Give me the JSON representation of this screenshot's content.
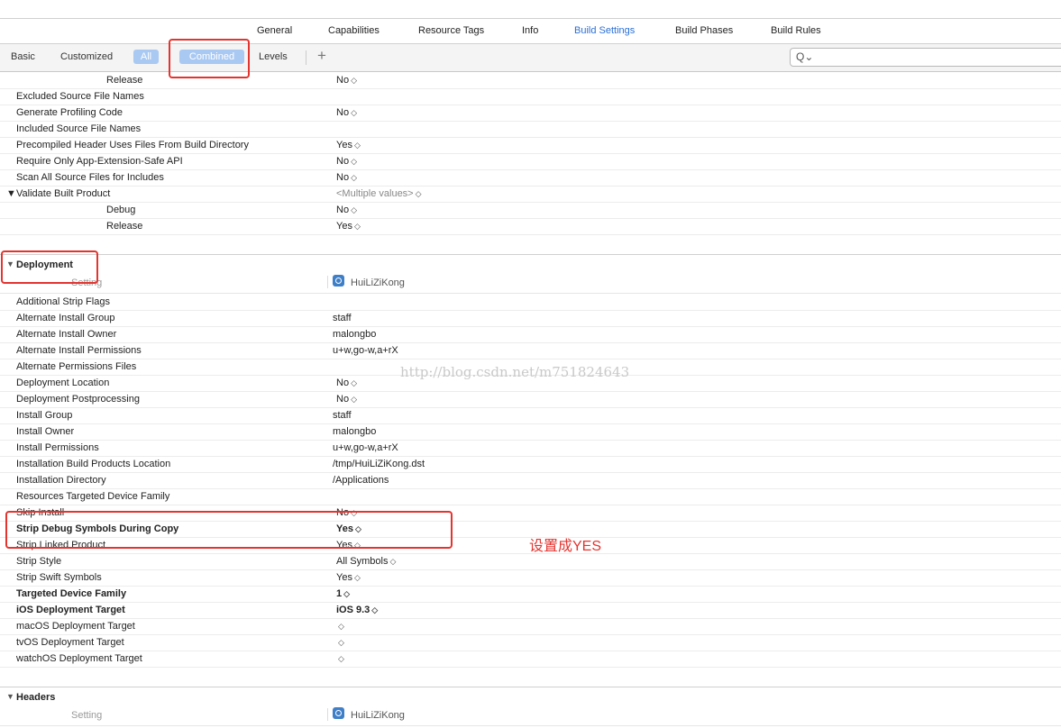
{
  "tabs": [
    "General",
    "Capabilities",
    "Resource Tags",
    "Info",
    "Build Settings",
    "Build Phases",
    "Build Rules"
  ],
  "active_tab": "Build Settings",
  "filter": {
    "basic": "Basic",
    "customized": "Customized",
    "all": "All",
    "combined": "Combined",
    "levels": "Levels",
    "plus": "+",
    "search_icon": "Q⌄"
  },
  "top_rows": [
    {
      "label": "Release",
      "value": "No"
    },
    {
      "label": "Excluded Source File Names",
      "value": ""
    },
    {
      "label": "Generate Profiling Code",
      "value": "No"
    },
    {
      "label": "Included Source File Names",
      "value": ""
    },
    {
      "label": "Precompiled Header Uses Files From Build Directory",
      "value": "Yes"
    },
    {
      "label": "Require Only App-Extension-Safe API",
      "value": "No"
    },
    {
      "label": "Scan All Source Files for Includes",
      "value": "No"
    },
    {
      "label": "Validate Built Product",
      "value": "<Multiple values>"
    },
    {
      "label": "Debug",
      "value": "No"
    },
    {
      "label": "Release",
      "value": "Yes"
    }
  ],
  "deployment": {
    "title": "Deployment",
    "col_setting": "Setting",
    "col_target": "HuiLiZiKong",
    "rows": [
      {
        "label": "Additional Strip Flags",
        "value": ""
      },
      {
        "label": "Alternate Install Group",
        "value": "staff"
      },
      {
        "label": "Alternate Install Owner",
        "value": "malongbo"
      },
      {
        "label": "Alternate Install Permissions",
        "value": "u+w,go-w,a+rX"
      },
      {
        "label": "Alternate Permissions Files",
        "value": ""
      },
      {
        "label": "Deployment Location",
        "value": "No"
      },
      {
        "label": "Deployment Postprocessing",
        "value": "No"
      },
      {
        "label": "Install Group",
        "value": "staff"
      },
      {
        "label": "Install Owner",
        "value": "malongbo"
      },
      {
        "label": "Install Permissions",
        "value": "u+w,go-w,a+rX"
      },
      {
        "label": "Installation Build Products Location",
        "value": "/tmp/HuiLiZiKong.dst"
      },
      {
        "label": "Installation Directory",
        "value": "/Applications"
      },
      {
        "label": "Resources Targeted Device Family",
        "value": ""
      },
      {
        "label": "Skip Install",
        "value": "No"
      },
      {
        "label": "Strip Debug Symbols During Copy",
        "value": "Yes"
      },
      {
        "label": "Strip Linked Product",
        "value": "Yes"
      },
      {
        "label": "Strip Style",
        "value": "All Symbols"
      },
      {
        "label": "Strip Swift Symbols",
        "value": "Yes"
      },
      {
        "label": "Targeted Device Family",
        "value": "1"
      },
      {
        "label": "iOS Deployment Target",
        "value": "iOS 9.3"
      },
      {
        "label": "macOS Deployment Target",
        "value": ""
      },
      {
        "label": "tvOS Deployment Target",
        "value": ""
      },
      {
        "label": "watchOS Deployment Target",
        "value": ""
      }
    ]
  },
  "headers": {
    "title": "Headers",
    "col_setting": "Setting",
    "col_target": "HuiLiZiKong"
  },
  "annotation": "设置成YES",
  "watermark": "http://blog.csdn.net/m751824643",
  "colors": {
    "accent": "#2a6fd6",
    "highlight": "#e3342f",
    "pill": "#a9c9f3"
  }
}
